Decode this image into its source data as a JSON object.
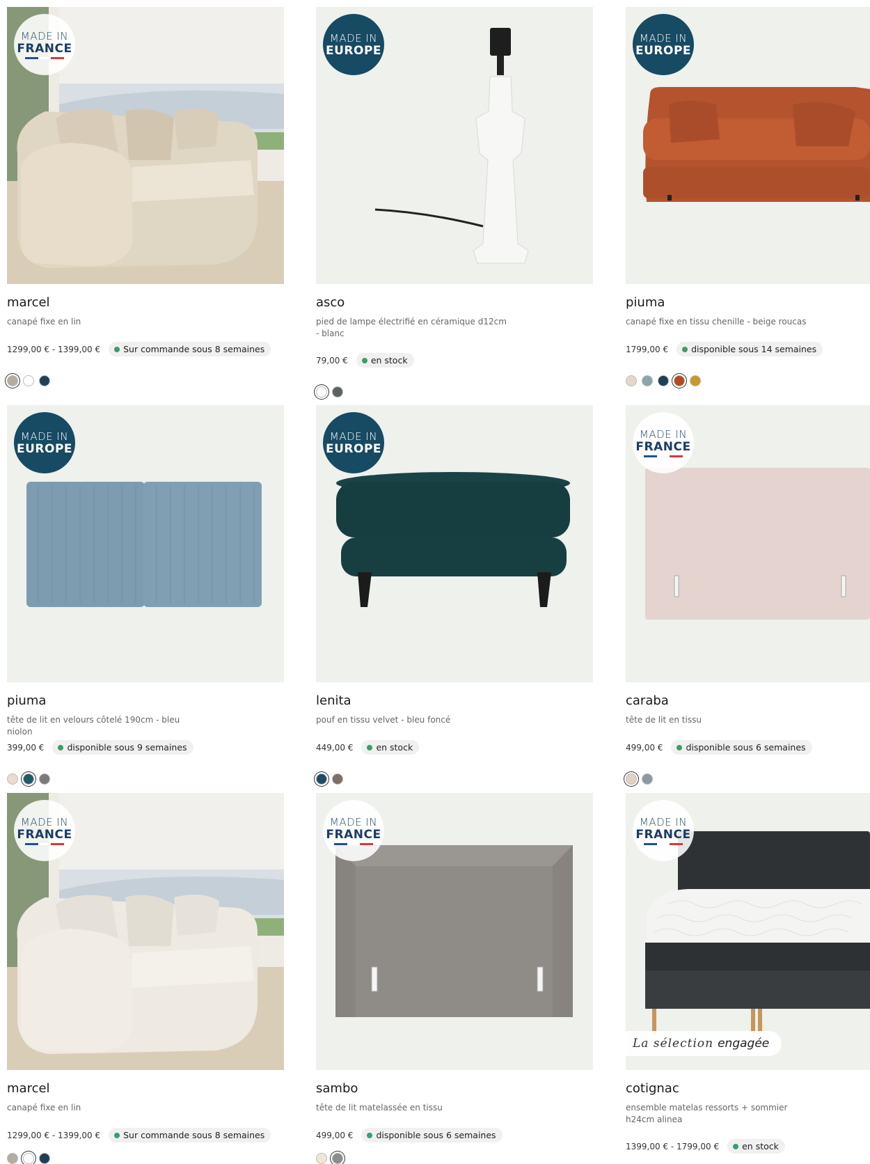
{
  "products": [
    {
      "name": "marcel",
      "desc": "canapé fixe en lin",
      "price": "1299,00 € - 1399,00 €",
      "stock": "Sur commande sous 8 semaines",
      "badge": {
        "line1": "MADE IN",
        "line2": "FRANCE"
      },
      "swatches": [
        "#b3ad9f",
        "#ffffff",
        "#1f3f58"
      ],
      "selected": 0
    },
    {
      "name": "asco",
      "desc": "pied de lampe électrifié en céramique d12cm - blanc",
      "price": "79,00 €",
      "stock": "en stock",
      "badge": {
        "line1": "MADE IN",
        "line2": "EUROPE"
      },
      "swatches": [
        "#ffffff",
        "#5b635f"
      ],
      "selected": 0
    },
    {
      "name": "piuma",
      "desc": "canapé fixe en tissu chenille - beige roucas",
      "price": "1799,00 €",
      "stock": "disponible sous 14 semaines",
      "badge": {
        "line1": "MADE IN",
        "line2": "EUROPE"
      },
      "swatches": [
        "#e5d8c6",
        "#8da4a9",
        "#1c4054",
        "#b34a1c",
        "#c89a2c"
      ],
      "selected": 3
    },
    {
      "name": "piuma",
      "desc": "tête de lit en velours côtelé 190cm - bleu niolon",
      "price": "399,00 €",
      "stock": "disponible sous 9 semaines",
      "badge": {
        "line1": "MADE IN",
        "line2": "EUROPE"
      },
      "swatches": [
        "#ecdcd0",
        "#1e5b6a",
        "#7a7a7a"
      ],
      "selected": 1
    },
    {
      "name": "lenita",
      "desc": "pouf en tissu velvet - bleu foncé",
      "price": "449,00 €",
      "stock": "en stock",
      "badge": {
        "line1": "MADE IN",
        "line2": "EUROPE"
      },
      "swatches": [
        "#1f4a66",
        "#7d6f66"
      ],
      "selected": 0
    },
    {
      "name": "caraba",
      "desc": "tête de lit en tissu",
      "price": "499,00 €",
      "stock": "disponible sous 6 semaines",
      "badge": {
        "line1": "MADE IN",
        "line2": "FRANCE"
      },
      "swatches": [
        "#e2d2c2",
        "#8c9aa0"
      ],
      "selected": 0
    },
    {
      "name": "marcel",
      "desc": "canapé fixe en lin",
      "price": "1299,00 € - 1399,00 €",
      "stock": "Sur commande sous 8 semaines",
      "badge": {
        "line1": "MADE IN",
        "line2": "FRANCE"
      },
      "swatches": [
        "#b3ad9f",
        "#ffffff",
        "#1f3f58"
      ],
      "selected": 1
    },
    {
      "name": "sambo",
      "desc": "tête de lit matelassée en tissu",
      "price": "499,00 €",
      "stock": "disponible sous 6 semaines",
      "badge": {
        "line1": "MADE IN",
        "line2": "FRANCE"
      },
      "swatches": [
        "#f1e6d6",
        "#8a8e90"
      ],
      "selected": 1
    },
    {
      "name": "cotignac",
      "desc": "ensemble matelas ressorts + sommier h24cm alinea",
      "price": "1399,00 € - 1799,00 €",
      "stock": "en stock",
      "badge": {
        "line1": "MADE IN",
        "line2": "FRANCE"
      },
      "selection_tag": {
        "script": "La sélection",
        "word": "engagée"
      },
      "swatches": [],
      "selected": -1
    }
  ],
  "colors": {
    "europe_badge": "#174a63",
    "stock_dot": "#3a9d6a",
    "flag_blue": "#1f4f9a",
    "flag_white": "#ffffff",
    "flag_red": "#d43a3a"
  }
}
